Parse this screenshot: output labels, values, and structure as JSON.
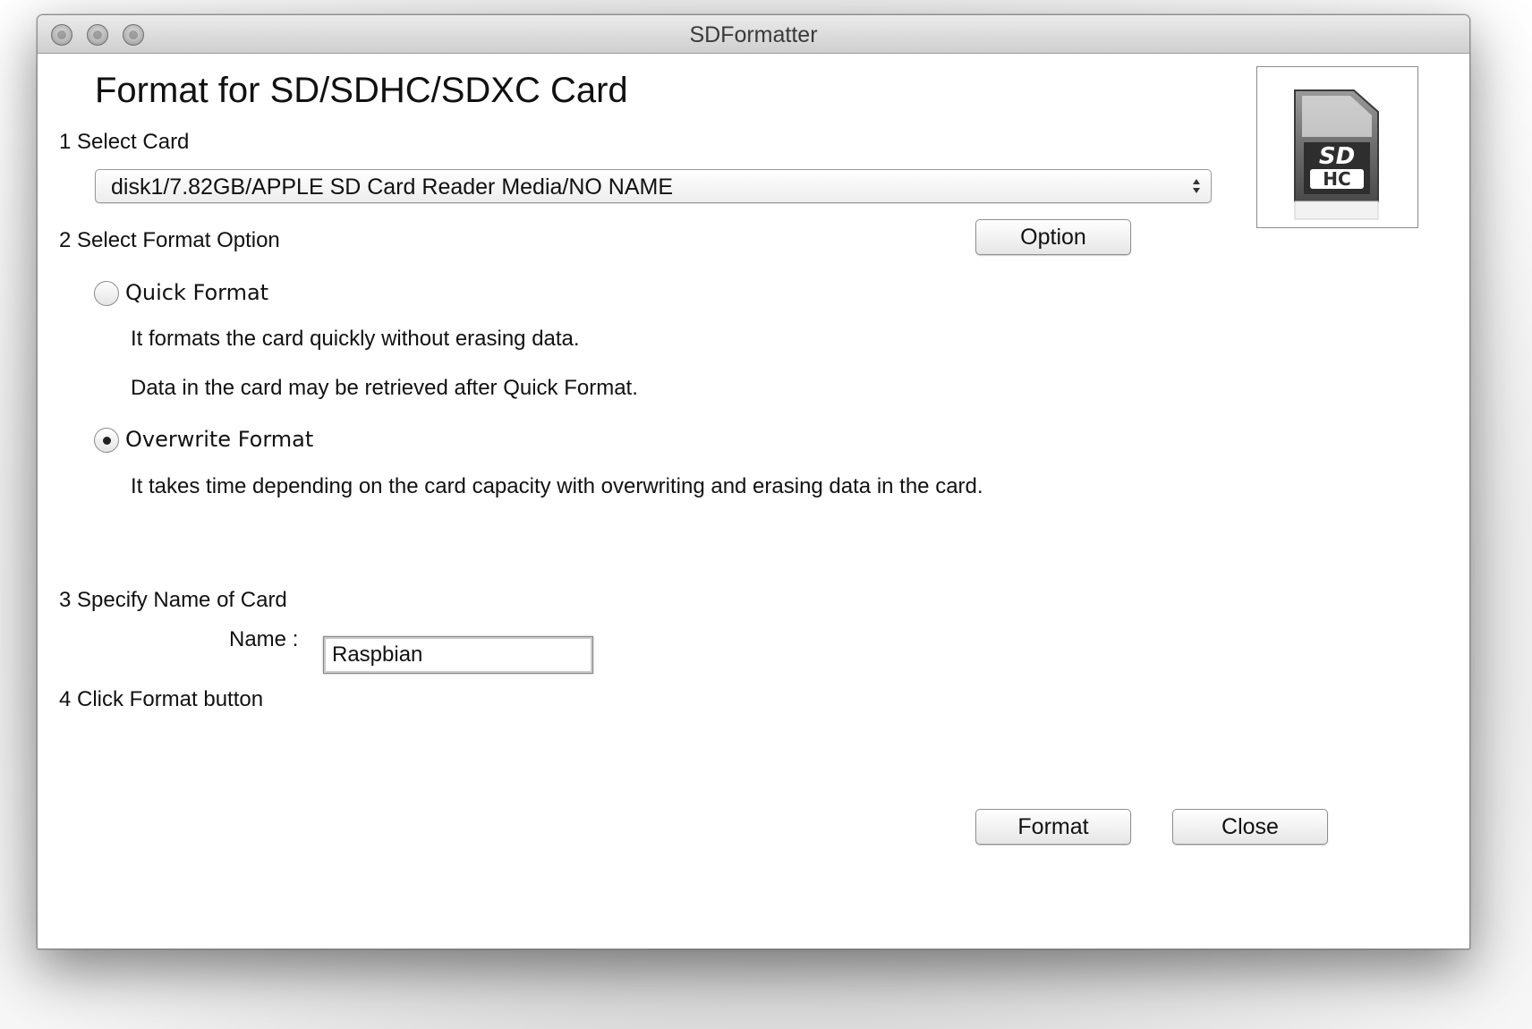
{
  "window": {
    "title": "SDFormatter"
  },
  "heading": "Format for SD/SDHC/SDXC Card",
  "steps": {
    "select_card": "1 Select Card",
    "select_format": "2 Select Format Option",
    "specify_name": "3 Specify Name of Card",
    "click_format": "4 Click Format button"
  },
  "card_select": {
    "value": "disk1/7.82GB/APPLE SD Card Reader Media/NO NAME"
  },
  "buttons": {
    "option": "Option",
    "format": "Format",
    "close": "Close"
  },
  "format_options": {
    "quick": {
      "label": "Quick Format",
      "selected": false,
      "desc1": "It formats the card quickly without erasing data.",
      "desc2": "Data in the card may be retrieved after Quick Format."
    },
    "overwrite": {
      "label": "Overwrite Format",
      "selected": true,
      "desc": "It takes time depending on the card capacity with overwriting and erasing data in the card."
    }
  },
  "name_field": {
    "label": "Name :",
    "value": "Raspbian"
  },
  "icons": {
    "card_logo": "sdhc-card-icon",
    "logo_text": "SD HC"
  }
}
